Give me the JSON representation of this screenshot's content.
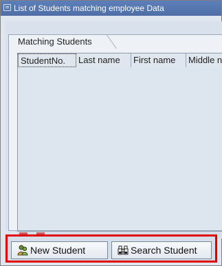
{
  "window": {
    "title": "List of Students matching employee Data"
  },
  "tab": {
    "label": "Matching Students"
  },
  "table": {
    "columns": [
      "StudentNo.",
      "Last name",
      "First name",
      "Middle name"
    ]
  },
  "toolbar": {
    "new_student_label": "New Student",
    "search_student_label": "Search Student"
  },
  "colors": {
    "title_bar": "#4f6ea6",
    "highlight_border": "#e00000"
  }
}
